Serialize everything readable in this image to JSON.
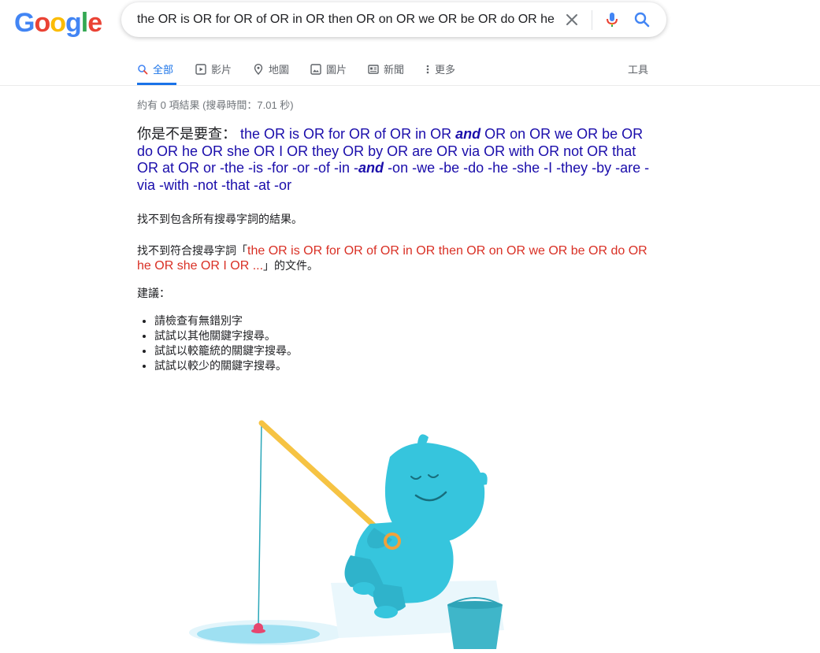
{
  "logo": {
    "letters": [
      "G",
      "o",
      "o",
      "g",
      "l",
      "e"
    ]
  },
  "search": {
    "query": "the OR is OR for OR of OR in OR then OR on OR we OR be OR do OR he"
  },
  "tabs": [
    {
      "label": "全部",
      "icon": "search-icon",
      "active": true
    },
    {
      "label": "影片",
      "icon": "video-icon",
      "active": false
    },
    {
      "label": "地圖",
      "icon": "map-pin-icon",
      "active": false
    },
    {
      "label": "圖片",
      "icon": "image-icon",
      "active": false
    },
    {
      "label": "新聞",
      "icon": "news-icon",
      "active": false
    },
    {
      "label": "更多",
      "icon": "more-vert-icon",
      "active": false
    }
  ],
  "tools_label": "工具",
  "stats": "約有 0 項結果 (搜尋時間：7.01 秒)",
  "did_you_mean": {
    "prefix": "你是不是要查：",
    "part1": "the OR is OR for OR of OR in OR ",
    "bold1": "and",
    "part2": " OR on OR we OR be OR do OR he OR she OR I OR they OR by OR are OR via OR with OR not OR that OR at OR or -the -is -for -or -of -in -",
    "bold2": "and",
    "part3": " -on -we -be -do -he -she -I -they -by -are -via -with -not -that -at -or"
  },
  "no_results_all": "找不到包含所有搜尋字詞的結果。",
  "no_results": {
    "prefix": "找不到符合搜尋字詞「",
    "query": "the OR is OR for OR of OR in OR then OR on OR we OR be OR do OR he OR she OR I OR ...",
    "suffix": "」的文件。"
  },
  "suggestions": {
    "title": "建議：",
    "items": [
      "請檢查有無錯別字",
      "試試以其他關鍵字搜尋。",
      "試試以較籠統的關鍵字搜尋。",
      "試試以較少的關鍵字搜尋。"
    ]
  },
  "colors": {
    "blue": "#4285F4",
    "red": "#EA4335",
    "yellow": "#FBBC05",
    "green": "#34A853",
    "link": "#1a0dab",
    "accent": "#1a73e8"
  }
}
